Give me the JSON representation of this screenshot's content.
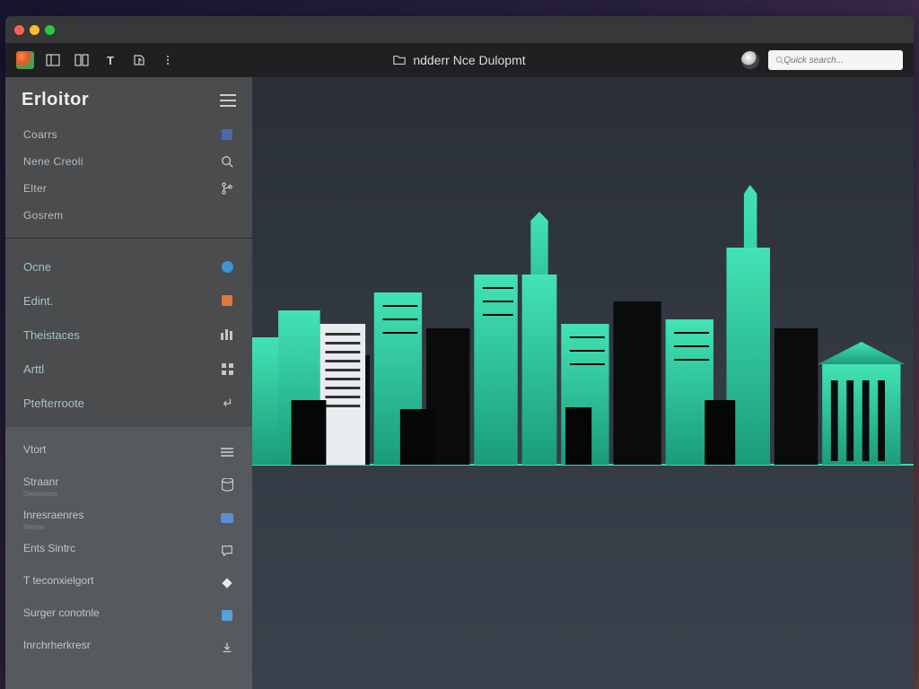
{
  "header": {
    "app_title": "ndderr Nce Dulopmt",
    "search_placeholder": "Quick search..."
  },
  "toolbar_icons": [
    "logo",
    "panel",
    "split",
    "text",
    "export",
    "more"
  ],
  "sidebar": {
    "title": "Erloitor",
    "section1": [
      {
        "label": "Coarrs",
        "icon": "file-icon"
      },
      {
        "label": "Nene Creoli",
        "icon": "search-icon"
      },
      {
        "label": "Elter",
        "icon": "branch-icon"
      },
      {
        "label": "Gosrem",
        "icon": ""
      }
    ],
    "section2": [
      {
        "label": "Ocne",
        "icon": "circle-blue-icon"
      },
      {
        "label": "Edint.",
        "icon": "square-orange-icon"
      },
      {
        "label": "Theistaces",
        "icon": "bars-icon"
      },
      {
        "label": "Arttl",
        "icon": "grid-icon"
      },
      {
        "label": "Ptefterroote",
        "icon": "return-icon"
      }
    ],
    "section3": [
      {
        "label": "Vtort",
        "sub": "",
        "icon": "lines-icon"
      },
      {
        "label": "Straanr",
        "sub": "Dieesrerss",
        "icon": "db-icon"
      },
      {
        "label": "Inresraenres",
        "sub": "Neess",
        "icon": "card-blue-icon"
      },
      {
        "label": "Ents Sintrc",
        "sub": "",
        "icon": "chat-icon"
      },
      {
        "label": "T teconxielgort",
        "sub": "",
        "icon": "diamond-icon"
      },
      {
        "label": "Surger conotnle",
        "sub": "",
        "icon": "square-lblue-icon"
      },
      {
        "label": "Inrchrherkresr",
        "sub": "",
        "icon": "download-icon"
      }
    ]
  },
  "colors": {
    "accent_green": "#3fd9b0",
    "accent_green_dark": "#1faa85",
    "canvas_bg": "#333a44"
  }
}
